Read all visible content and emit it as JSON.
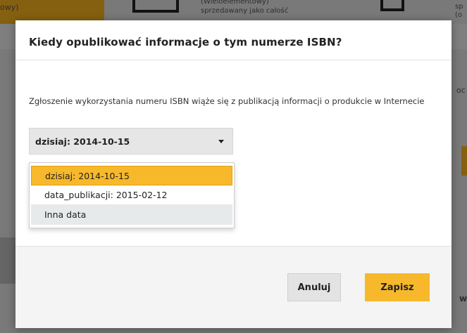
{
  "background": {
    "fragment_top_left": "owy)",
    "fragment_top_mid_1": "(Wieloelementowy)",
    "fragment_top_mid_2": "sprzedawany jako całość",
    "fragment_top_right_1": "sp",
    "fragment_top_right_2": "(o",
    "fragment_right_mid": "oc",
    "fragment_right_bottom": "w"
  },
  "modal": {
    "title": "Kiedy opublikować informacje o tym numerze ISBN?",
    "description": "Zgłoszenie wykorzystania numeru ISBN wiąże się z publikacją informacji o produkcie w Internecie",
    "select": {
      "value": "dzisiaj: 2014-10-15",
      "options": [
        "dzisiaj: 2014-10-15",
        "data_publikacji: 2015-02-12",
        "Inna data"
      ]
    },
    "buttons": {
      "cancel": "Anuluj",
      "save": "Zapisz"
    }
  },
  "colors": {
    "accent": "#f7b82b",
    "overlay": "rgba(0,0,0,0.45)"
  },
  "icons": {
    "select_caret": "chevron-down-icon"
  }
}
